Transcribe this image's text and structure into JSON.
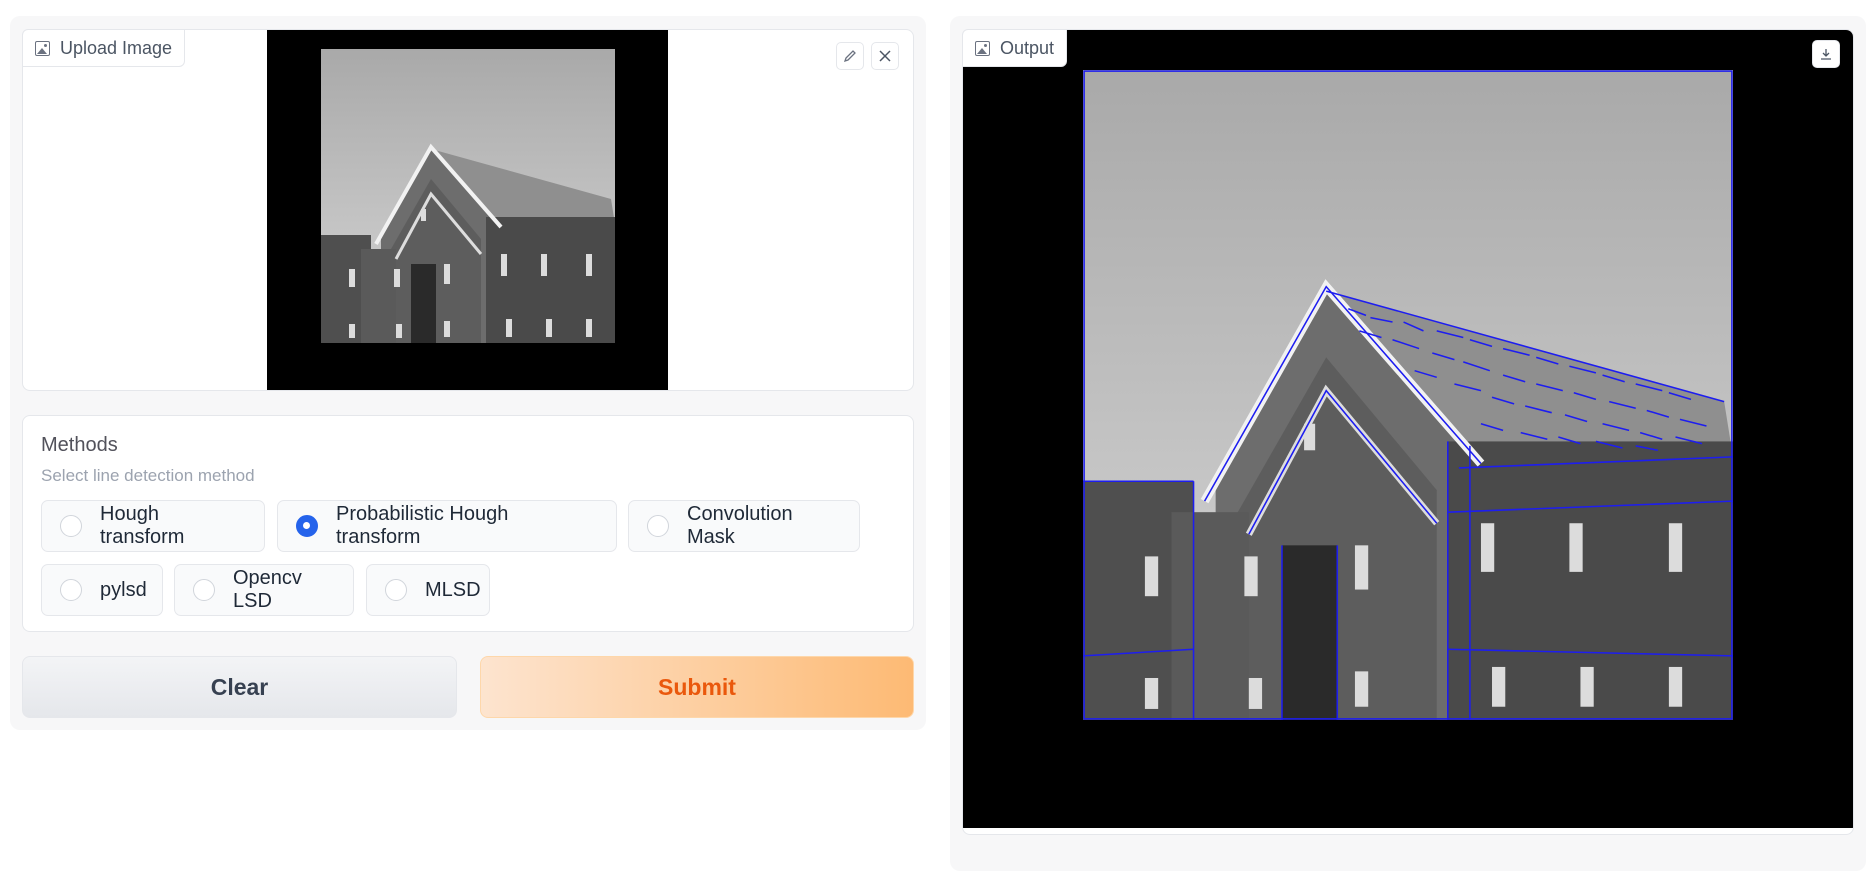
{
  "upload": {
    "label": "Upload Image",
    "edit_icon": "pencil-icon",
    "close_icon": "close-icon"
  },
  "methods": {
    "title": "Methods",
    "subtitle": "Select line detection method",
    "options": [
      {
        "label": "Hough transform",
        "checked": false
      },
      {
        "label": "Probabilistic Hough transform",
        "checked": true
      },
      {
        "label": "Convolution Mask",
        "checked": false
      },
      {
        "label": "pylsd",
        "checked": false
      },
      {
        "label": "Opencv LSD",
        "checked": false
      },
      {
        "label": "MLSD",
        "checked": false
      }
    ]
  },
  "actions": {
    "clear_label": "Clear",
    "submit_label": "Submit"
  },
  "output": {
    "label": "Output",
    "download_icon": "download-icon"
  },
  "colors": {
    "accent": "#2563eb",
    "submit_text": "#ea580c",
    "submit_bg": "#fdba74",
    "detected_lines": "#1d1df0"
  }
}
